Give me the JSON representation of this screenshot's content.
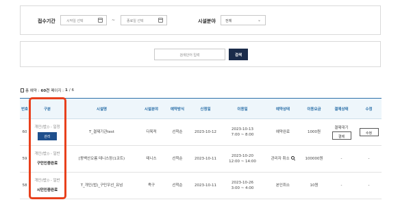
{
  "filters": {
    "period_label": "접수기간",
    "start_placeholder": "시작일 선택",
    "end_placeholder": "종료일 선택",
    "separator": "~",
    "field_label": "시설분야",
    "field_value": "전체"
  },
  "search": {
    "placeholder": "검색단어 입력",
    "button_label": "검색"
  },
  "summary": {
    "prefix": "총 예약 : ",
    "total": "60건",
    "middle": " 페이지 : ",
    "page": "1",
    "suffix": " / 6"
  },
  "table": {
    "headers": [
      "번호",
      "구분",
      "시설명",
      "시설분야",
      "예약방식",
      "신청일",
      "이용일",
      "예약상태",
      "이용요금",
      "결제상태",
      "수정"
    ],
    "rows": [
      {
        "no": "60",
        "type_note": "개인(법)) - 일정",
        "type_action": "관리",
        "facility": "T_결제기관test",
        "field": "다목적",
        "method": "선착순",
        "applied": "2023-10-12",
        "use_date": "2023-10-13",
        "use_time": "7:00 ~ 8:00",
        "status": "예약완료",
        "fee": "1000원",
        "pay_status": "결제대기",
        "pay_button": "결제",
        "edit": "수정"
      },
      {
        "no": "59",
        "type_note": "개인(법)) - 일반",
        "type_action": "구민인증완료",
        "facility": "[동백산오름 테니스장(1코트)",
        "field": "테니스",
        "method": "선착순",
        "applied": "2023-10-11",
        "use_date": "2023-10-20",
        "use_time": "12:00 ~ 14:00",
        "status": "관리자 취소",
        "fee": "100000원",
        "pay_status": "-",
        "edit": "-"
      },
      {
        "no": "58",
        "type_note": "개인(법)) - 일반",
        "type_action": "시민인증완료",
        "facility": "T_개인(법)_구민우선_유넘",
        "field": "족구",
        "method": "선착순",
        "applied": "2023-10-11",
        "use_date": "2023-10-26",
        "use_time": "3:00 ~ 4:00",
        "status": "본인취소",
        "fee": "10원",
        "pay_status": "-",
        "edit": "-"
      }
    ]
  },
  "colors": {
    "header_text": "#2a6fa8",
    "header_bg": "#eef6fb",
    "highlight": "#e8401c",
    "primary_button": "#1a2b4a"
  }
}
